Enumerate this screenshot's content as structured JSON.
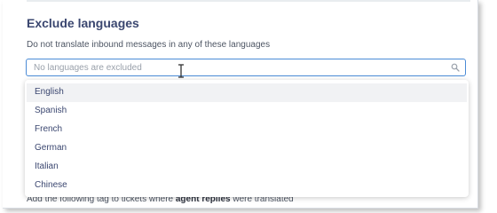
{
  "section": {
    "title": "Exclude languages",
    "description": "Do not translate inbound messages in any of these languages"
  },
  "search": {
    "placeholder": "No languages are excluded",
    "icon": "search-icon"
  },
  "dropdown": {
    "options": [
      "English",
      "Spanish",
      "French",
      "German",
      "Italian",
      "Chinese"
    ],
    "highlighted_index": 0
  },
  "tag_note": {
    "prefix": "Add the following tag to tickets where ",
    "bold": "agent replies",
    "suffix": " were translated"
  },
  "colors": {
    "accent_border": "#4b8bd6",
    "heading": "#3b4770",
    "highlight_bg": "#f1f2f4"
  }
}
